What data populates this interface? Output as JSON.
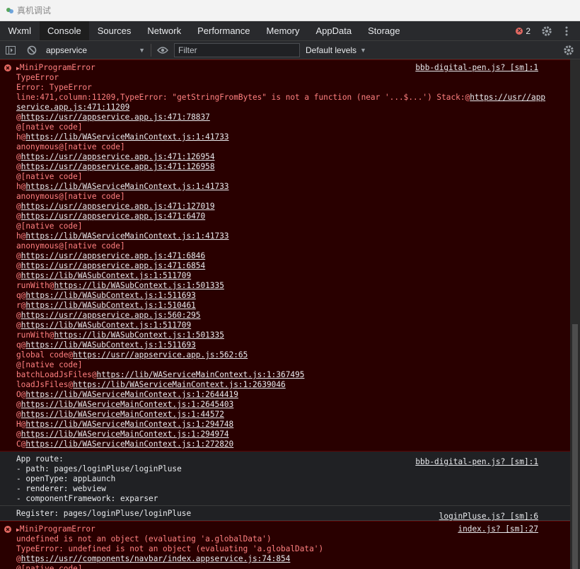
{
  "window": {
    "title": "真机调试"
  },
  "tabs": [
    "Wxml",
    "Console",
    "Sources",
    "Network",
    "Performance",
    "Memory",
    "AppData",
    "Storage"
  ],
  "active_tab": "Console",
  "error_count": "2",
  "toolbar": {
    "context": "appservice",
    "filter_placeholder": "Filter",
    "levels": "Default levels"
  },
  "messages": [
    {
      "type": "error",
      "source": "bbb-digital-pen.js? [sm]:1",
      "lines": [
        [
          {
            "t": "▶",
            "k": "tri"
          },
          {
            "t": "MiniProgramError"
          }
        ],
        [
          {
            "t": "TypeError"
          }
        ],
        [
          {
            "t": "Error: TypeError"
          }
        ],
        [
          {
            "t": "line:471,column:11209,TypeError: \"getStringFromBytes\" is not a function (near '...$...') Stack:@"
          },
          {
            "t": "https://usr//app",
            "k": "link"
          }
        ],
        [
          {
            "t": "service.app.js:471:11209",
            "k": "link"
          }
        ],
        [
          {
            "t": "@"
          },
          {
            "t": "https://usr//appservice.app.js:471:78837",
            "k": "link"
          }
        ],
        [
          {
            "t": "@[native code]"
          }
        ],
        [
          {
            "t": "h@"
          },
          {
            "t": "https://lib/WAServiceMainContext.js:1:41733",
            "k": "link"
          }
        ],
        [
          {
            "t": "anonymous@[native code]"
          }
        ],
        [
          {
            "t": "@"
          },
          {
            "t": "https://usr//appservice.app.js:471:126954",
            "k": "link"
          }
        ],
        [
          {
            "t": "@"
          },
          {
            "t": "https://usr//appservice.app.js:471:126958",
            "k": "link"
          }
        ],
        [
          {
            "t": "@[native code]"
          }
        ],
        [
          {
            "t": "h@"
          },
          {
            "t": "https://lib/WAServiceMainContext.js:1:41733",
            "k": "link"
          }
        ],
        [
          {
            "t": "anonymous@[native code]"
          }
        ],
        [
          {
            "t": "@"
          },
          {
            "t": "https://usr//appservice.app.js:471:127019",
            "k": "link"
          }
        ],
        [
          {
            "t": "@"
          },
          {
            "t": "https://usr//appservice.app.js:471:6470",
            "k": "link"
          }
        ],
        [
          {
            "t": "@[native code]"
          }
        ],
        [
          {
            "t": "h@"
          },
          {
            "t": "https://lib/WAServiceMainContext.js:1:41733",
            "k": "link"
          }
        ],
        [
          {
            "t": "anonymous@[native code]"
          }
        ],
        [
          {
            "t": "@"
          },
          {
            "t": "https://usr//appservice.app.js:471:6846",
            "k": "link"
          }
        ],
        [
          {
            "t": "@"
          },
          {
            "t": "https://usr//appservice.app.js:471:6854",
            "k": "link"
          }
        ],
        [
          {
            "t": "@"
          },
          {
            "t": "https://lib/WASubContext.js:1:511709",
            "k": "link"
          }
        ],
        [
          {
            "t": "runWith@"
          },
          {
            "t": "https://lib/WASubContext.js:1:501335",
            "k": "link"
          }
        ],
        [
          {
            "t": "q@"
          },
          {
            "t": "https://lib/WASubContext.js:1:511693",
            "k": "link"
          }
        ],
        [
          {
            "t": "r@"
          },
          {
            "t": "https://lib/WASubContext.js:1:510461",
            "k": "link"
          }
        ],
        [
          {
            "t": "@"
          },
          {
            "t": "https://usr//appservice.app.js:560:295",
            "k": "link"
          }
        ],
        [
          {
            "t": "@"
          },
          {
            "t": "https://lib/WASubContext.js:1:511709",
            "k": "link"
          }
        ],
        [
          {
            "t": "runWith@"
          },
          {
            "t": "https://lib/WASubContext.js:1:501335",
            "k": "link"
          }
        ],
        [
          {
            "t": "q@"
          },
          {
            "t": "https://lib/WASubContext.js:1:511693",
            "k": "link"
          }
        ],
        [
          {
            "t": "global code@"
          },
          {
            "t": "https://usr//appservice.app.js:562:65",
            "k": "link"
          }
        ],
        [
          {
            "t": "@[native code]"
          }
        ],
        [
          {
            "t": "batchLoadJsFiles@"
          },
          {
            "t": "https://lib/WAServiceMainContext.js:1:367495",
            "k": "link"
          }
        ],
        [
          {
            "t": "loadJsFiles@"
          },
          {
            "t": "https://lib/WAServiceMainContext.js:1:2639046",
            "k": "link"
          }
        ],
        [
          {
            "t": "O@"
          },
          {
            "t": "https://lib/WAServiceMainContext.js:1:2644419",
            "k": "link"
          }
        ],
        [
          {
            "t": "@"
          },
          {
            "t": "https://lib/WAServiceMainContext.js:1:2645403",
            "k": "link"
          }
        ],
        [
          {
            "t": "@"
          },
          {
            "t": "https://lib/WAServiceMainContext.js:1:44572",
            "k": "link"
          }
        ],
        [
          {
            "t": "H@"
          },
          {
            "t": "https://lib/WAServiceMainContext.js:1:294748",
            "k": "link"
          }
        ],
        [
          {
            "t": "@"
          },
          {
            "t": "https://lib/WAServiceMainContext.js:1:294974",
            "k": "link"
          }
        ],
        [
          {
            "t": "C@"
          },
          {
            "t": "https://lib/WAServiceMainContext.js:1:272820",
            "k": "link"
          }
        ]
      ]
    },
    {
      "type": "info",
      "source": "bbb-digital-pen.js? [sm]:1",
      "lines": [
        [
          {
            "t": "App route:"
          }
        ],
        [
          {
            "t": "- path: pages/loginPluse/loginPluse"
          }
        ],
        [
          {
            "t": "- openType: appLaunch"
          }
        ],
        [
          {
            "t": "- renderer: webview"
          }
        ],
        [
          {
            "t": "- componentFramework: exparser"
          }
        ]
      ]
    },
    {
      "type": "info",
      "source": "loginPluse.js? [sm]:6",
      "lines": [
        [
          {
            "t": "Register: pages/loginPluse/loginPluse"
          }
        ]
      ]
    },
    {
      "type": "error",
      "source": "index.js? [sm]:27",
      "lines": [
        [
          {
            "t": "▶",
            "k": "tri"
          },
          {
            "t": "MiniProgramError"
          }
        ],
        [
          {
            "t": "undefined is not an object (evaluating 'a.globalData')"
          }
        ],
        [
          {
            "t": "TypeError: undefined is not an object (evaluating 'a.globalData')"
          }
        ],
        [
          {
            "t": "@"
          },
          {
            "t": "https://usr//components/navbar/index.appservice.js:74:854",
            "k": "link"
          }
        ],
        [
          {
            "t": "@[native code]"
          }
        ]
      ]
    }
  ]
}
